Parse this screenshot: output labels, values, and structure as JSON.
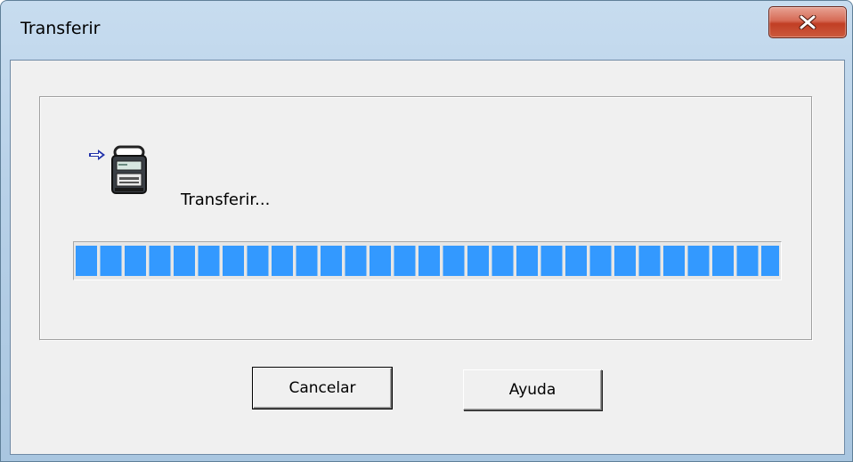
{
  "window": {
    "title": "Transferir"
  },
  "titlebar": {
    "close_icon": "close-x-icon"
  },
  "content": {
    "arrow_icon": "right-arrow-icon",
    "device_icon": "label-printer-icon",
    "status_text": "Transferir...",
    "progress": {
      "percent": 100
    }
  },
  "buttons": {
    "cancel_label": "Cancelar",
    "help_label": "Ayuda"
  },
  "colors": {
    "progress_fill": "#3399ff",
    "titlebar": "#b8d1e8",
    "close_button": "#c13e24",
    "dialog_background": "#f0f0f0"
  }
}
